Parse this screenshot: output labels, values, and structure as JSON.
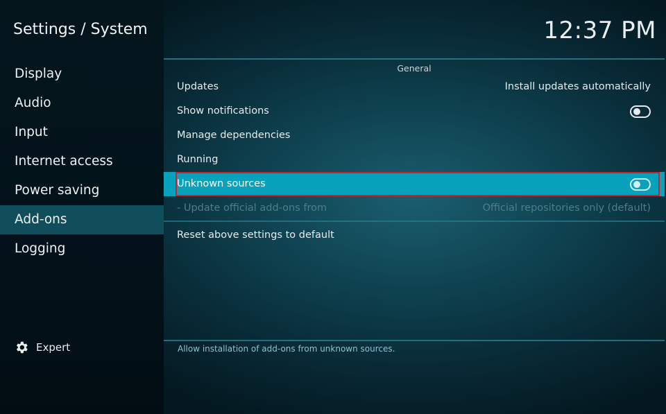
{
  "header": {
    "title": "Settings / System",
    "clock": "12:37 PM"
  },
  "sidebar": {
    "items": [
      {
        "label": "Display"
      },
      {
        "label": "Audio"
      },
      {
        "label": "Input"
      },
      {
        "label": "Internet access"
      },
      {
        "label": "Power saving"
      },
      {
        "label": "Add-ons",
        "active": true
      },
      {
        "label": "Logging"
      }
    ],
    "expert_label": "Expert"
  },
  "panel": {
    "group_title": "General",
    "rows": [
      {
        "label": "Updates",
        "value": "Install updates automatically"
      },
      {
        "label": "Show notifications",
        "toggle": "off"
      },
      {
        "label": "Manage dependencies"
      },
      {
        "label": "Running"
      },
      {
        "label": "Unknown sources",
        "toggle": "off",
        "selected": true
      },
      {
        "label": "- Update official add-ons from",
        "value": "Official repositories only (default)",
        "disabled": true
      }
    ],
    "reset_label": "Reset above settings to default"
  },
  "help_text": "Allow installation of add-ons from unknown sources.",
  "colors": {
    "selected_row": "#08a2bd",
    "highlight_box": "#d0202a",
    "active_nav": "#114e5b"
  }
}
